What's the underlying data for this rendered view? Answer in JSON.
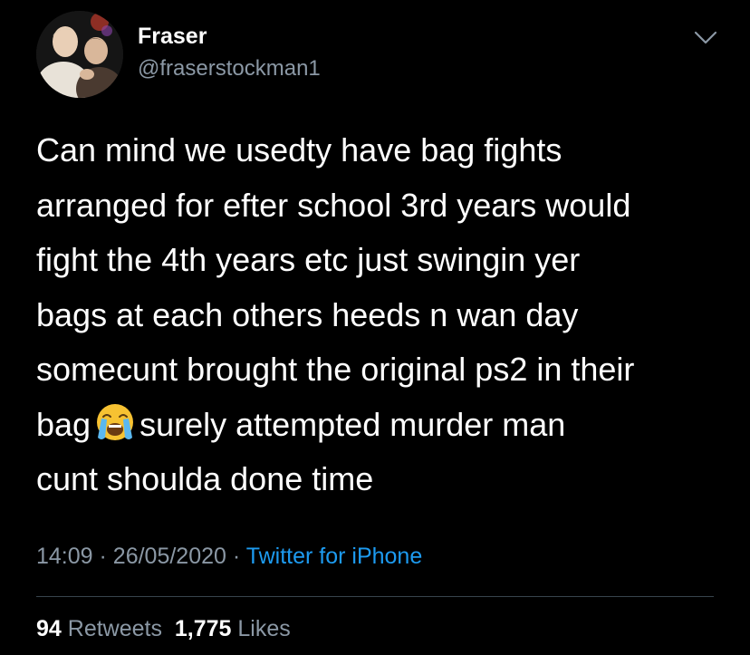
{
  "user": {
    "name": "Fraser",
    "handle": "@fraserstockman1"
  },
  "tweet": {
    "lines": [
      "Can mind we usedty have bag fights",
      "arranged for efter school 3rd years would",
      "fight the 4th years etc just swingin yer",
      "bags at each others heeds n wan day",
      "somecunt brought the original ps2 in their",
      "bag",
      "surely attempted murder man",
      "cunt shoulda done time"
    ],
    "emoji": "loudly-crying-face-icon"
  },
  "meta": {
    "time": "14:09",
    "separator": "·",
    "date": "26/05/2020",
    "source": "Twitter for iPhone"
  },
  "stats": {
    "retweets_count": "94",
    "retweets_label": "Retweets",
    "likes_count": "1,775",
    "likes_label": "Likes"
  },
  "colors": {
    "background": "#000000",
    "text": "#ffffff",
    "secondary": "#8b98a5",
    "link": "#1d9bf0",
    "divider": "#38444d"
  }
}
